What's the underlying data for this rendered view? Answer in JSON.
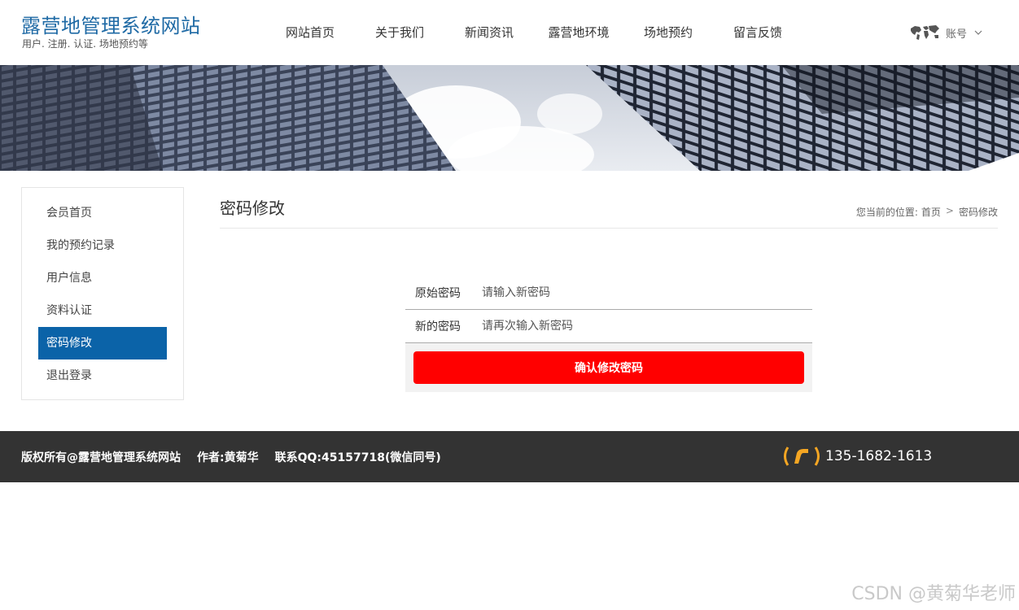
{
  "site": {
    "title": "露营地管理系统网站",
    "subtitle": "用户. 注册. 认证. 场地预约等"
  },
  "nav": {
    "items": [
      "网站首页",
      "关于我们",
      "新闻资讯",
      "露营地环境",
      "场地预约",
      "留言反馈"
    ],
    "account_label": "账号",
    "account_icon": "world-map-icon",
    "dropdown_icon": "chevron-down-icon"
  },
  "sidebar": {
    "items": [
      "会员首页",
      "我的预约记录",
      "用户信息",
      "资料认证",
      "密码修改",
      "退出登录"
    ],
    "active_index": 4,
    "active_color": "#0b63a8"
  },
  "main": {
    "title": "密码修改",
    "breadcrumb": {
      "prefix": "您当前的位置:",
      "home": "首页",
      "separator": ">",
      "current": "密码修改"
    }
  },
  "form": {
    "old_label": "原始密码",
    "old_placeholder": "请输入新密码",
    "old_value": "",
    "new_label": "新的密码",
    "new_placeholder": "请再次输入新密码",
    "new_value": "",
    "submit_label": "确认修改密码",
    "submit_color": "#ff0000"
  },
  "footer": {
    "copyright": "版权所有@露营地管理系统网站",
    "author": "作者:黄菊华",
    "contact": "联系QQ:45157718(微信同号)",
    "phone": "135-1682-1613",
    "phone_icon": "phone-icon",
    "phone_icon_color": "#f5a623",
    "background": "#333333"
  },
  "watermark": "CSDN @黄菊华老师"
}
